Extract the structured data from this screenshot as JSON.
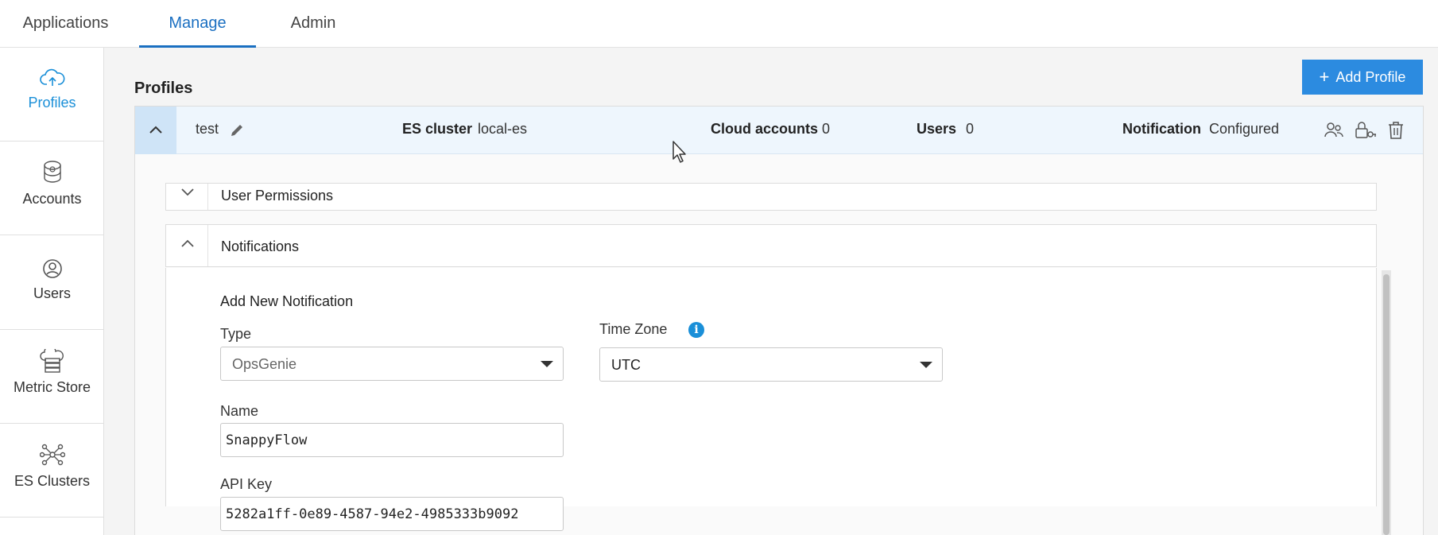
{
  "topnav": {
    "tabs": [
      {
        "label": "Applications"
      },
      {
        "label": "Manage"
      },
      {
        "label": "Admin"
      }
    ]
  },
  "sidebar": {
    "items": [
      {
        "label": "Profiles",
        "icon": "cloud-upload-icon"
      },
      {
        "label": "Accounts",
        "icon": "accounts-icon"
      },
      {
        "label": "Users",
        "icon": "user-circle-icon"
      },
      {
        "label": "Metric Store",
        "icon": "metric-store-icon"
      },
      {
        "label": "ES Clusters",
        "icon": "cluster-icon"
      }
    ]
  },
  "page": {
    "title": "Profiles",
    "add_button_label": "Add Profile",
    "add_button_icon": "+"
  },
  "profile": {
    "name": "test",
    "es_cluster_label": "ES cluster",
    "es_cluster_value": "local-es",
    "cloud_accounts_label": "Cloud accounts",
    "cloud_accounts_value": "0",
    "users_label": "Users",
    "users_value": "0",
    "notification_label": "Notification",
    "notification_value": "Configured"
  },
  "sections": {
    "user_permissions": "User Permissions",
    "notifications": "Notifications"
  },
  "notification_form": {
    "heading": "Add New Notification",
    "type_label": "Type",
    "type_value": "OpsGenie",
    "timezone_label": "Time Zone",
    "timezone_value": "UTC",
    "name_label": "Name",
    "name_value": "SnappyFlow",
    "api_key_label": "API Key",
    "api_key_value": "5282a1ff-0e89-4587-94e2-4985333b9092"
  },
  "colors": {
    "accent": "#1a6fc1",
    "button": "#2c8be0",
    "info": "#1a8fd8"
  }
}
